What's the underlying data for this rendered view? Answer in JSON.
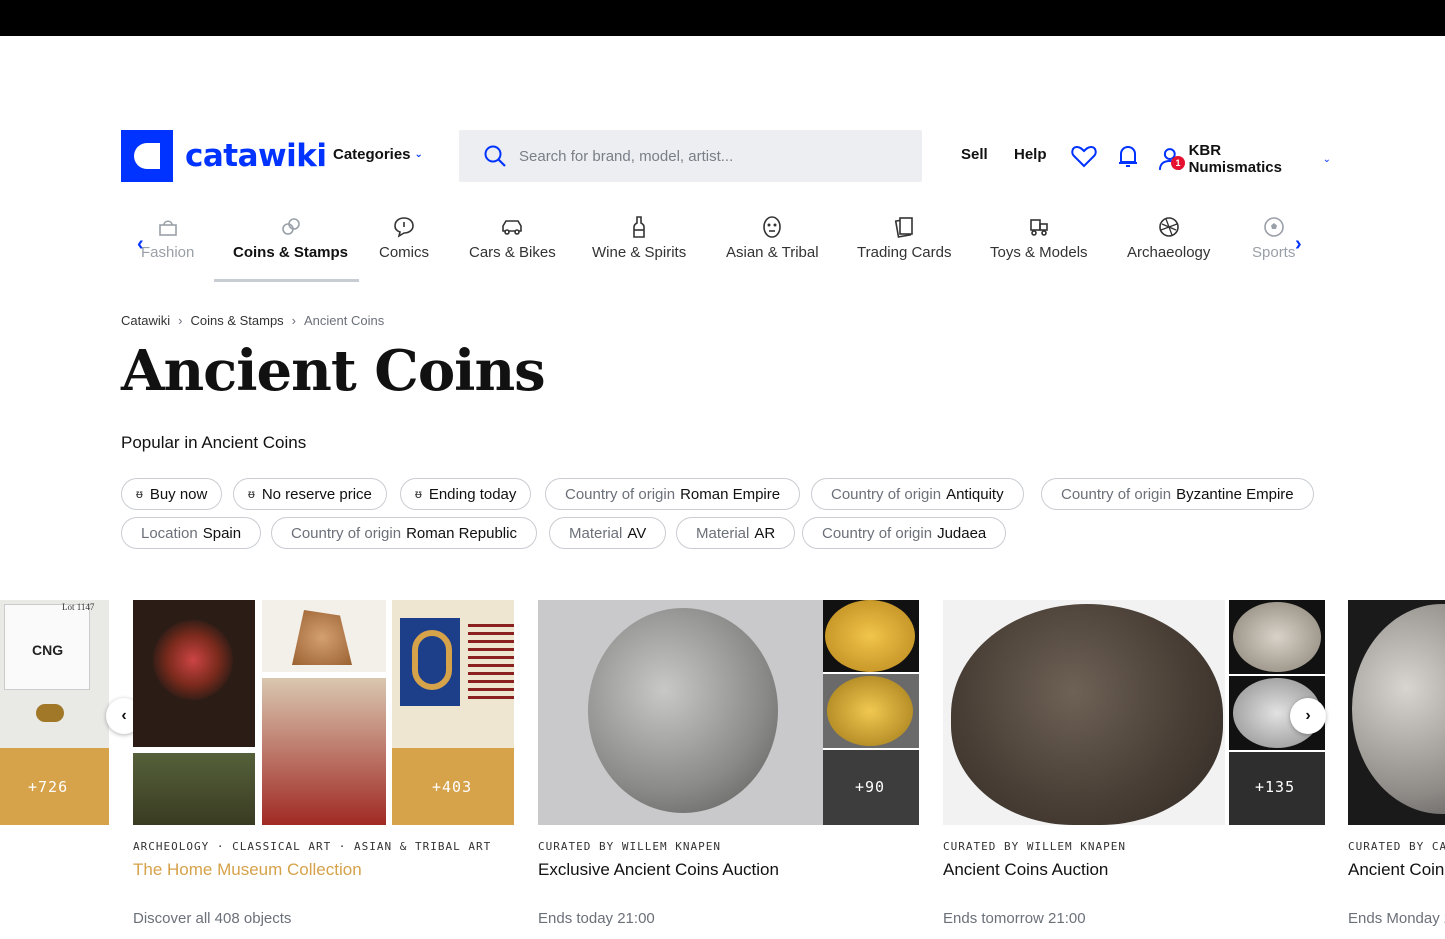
{
  "header": {
    "logo_text": "catawiki",
    "categories_label": "Categories",
    "search_placeholder": "Search for brand, model, artist...",
    "sell_label": "Sell",
    "help_label": "Help",
    "notification_count": "1",
    "user_name": "KBR Numismatics"
  },
  "catnav": {
    "items": [
      {
        "label": "Fashion",
        "icon": "handbag-icon"
      },
      {
        "label": "Coins & Stamps",
        "icon": "coins-icon"
      },
      {
        "label": "Comics",
        "icon": "speech-bubble-icon"
      },
      {
        "label": "Cars & Bikes",
        "icon": "car-icon"
      },
      {
        "label": "Wine & Spirits",
        "icon": "bottle-icon"
      },
      {
        "label": "Asian & Tribal",
        "icon": "mask-icon"
      },
      {
        "label": "Trading Cards",
        "icon": "cards-icon"
      },
      {
        "label": "Toys & Models",
        "icon": "toy-train-icon"
      },
      {
        "label": "Archaeology",
        "icon": "amphora-icon"
      },
      {
        "label": "Sports",
        "icon": "football-icon"
      }
    ],
    "active": "Coins & Stamps"
  },
  "breadcrumb": [
    "Catawiki",
    "Coins & Stamps",
    "Ancient Coins"
  ],
  "page_title": "Ancient Coins",
  "popular_heading": "Popular in Ancient Coins",
  "chips": [
    {
      "value": "Buy now",
      "pinned": true
    },
    {
      "value": "No reserve price",
      "pinned": true
    },
    {
      "value": "Ending today",
      "pinned": true
    },
    {
      "key": "Country of origin",
      "value": "Roman Empire"
    },
    {
      "key": "Country of origin",
      "value": "Antiquity"
    },
    {
      "key": "Country of origin",
      "value": "Byzantine Empire"
    },
    {
      "key": "Location",
      "value": "Spain"
    },
    {
      "key": "Country of origin",
      "value": "Roman Republic"
    },
    {
      "key": "Material",
      "value": "AV"
    },
    {
      "key": "Material",
      "value": "AR"
    },
    {
      "key": "Country of origin",
      "value": "Judaea"
    }
  ],
  "cards": [
    {
      "more": "+726"
    },
    {
      "more": "+403",
      "subtitle": "ARCHEOLOGY · CLASSICAL ART · ASIAN & TRIBAL ART",
      "title": "The Home Museum Collection",
      "meta": "Discover all 408 objects"
    },
    {
      "more": "+90",
      "subtitle": "CURATED BY WILLEM KNAPEN",
      "title": "Exclusive Ancient Coins Auction",
      "meta": "Ends today 21:00"
    },
    {
      "more": "+135",
      "subtitle": "CURATED BY WILLEM KNAPEN",
      "title": "Ancient Coins Auction",
      "meta": "Ends tomorrow 21:00"
    },
    {
      "subtitle": "CURATED BY CA",
      "title": "Ancient Coin",
      "meta": "Ends Monday 2"
    }
  ],
  "photo_labels": {
    "lot_label": "Lot 1147",
    "cng_label": "CNG"
  },
  "colors": {
    "brand_blue": "#0033ff",
    "gold": "#d6a24a",
    "badge_red": "#e5112e"
  }
}
